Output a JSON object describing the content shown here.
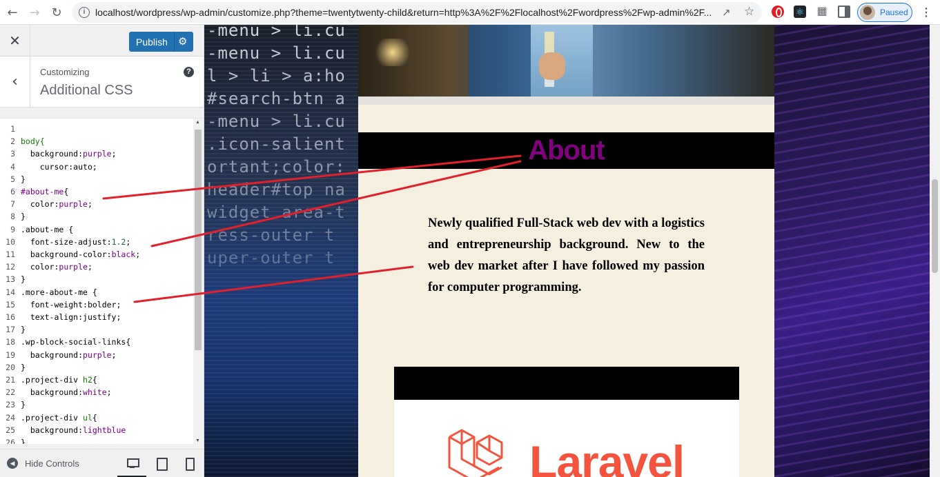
{
  "browser": {
    "url": "localhost/wordpress/wp-admin/customize.php?theme=twentytwenty-child&return=http%3A%2F%2Flocalhost%2Fwordpress%2Fwp-admin%2F...",
    "profile_status": "Paused"
  },
  "customizer": {
    "publish_label": "Publish",
    "customizing_label": "Customizing",
    "section_title": "Additional CSS",
    "hide_controls_label": "Hide Controls",
    "css_lines": [
      {
        "n": "1",
        "tokens": []
      },
      {
        "n": "2",
        "tokens": [
          {
            "t": "body{",
            "c": "sel"
          }
        ]
      },
      {
        "n": "3",
        "tokens": [
          {
            "t": "  background:",
            "c": "prop"
          },
          {
            "t": "purple",
            "c": "val"
          },
          {
            "t": ";",
            "c": "prop"
          }
        ]
      },
      {
        "n": "4",
        "tokens": [
          {
            "t": "    cursor:",
            "c": "prop"
          },
          {
            "t": "auto",
            "c": "prop"
          },
          {
            "t": ";",
            "c": "prop"
          }
        ]
      },
      {
        "n": "5",
        "tokens": [
          {
            "t": "}",
            "c": "prop"
          }
        ]
      },
      {
        "n": "6",
        "tokens": [
          {
            "t": "#about-me",
            "c": "id"
          },
          {
            "t": "{",
            "c": "prop"
          }
        ]
      },
      {
        "n": "7",
        "tokens": [
          {
            "t": "  color:",
            "c": "prop"
          },
          {
            "t": "purple",
            "c": "val"
          },
          {
            "t": ";",
            "c": "prop"
          }
        ]
      },
      {
        "n": "8",
        "tokens": [
          {
            "t": "}",
            "c": "prop"
          }
        ]
      },
      {
        "n": "9",
        "tokens": [
          {
            "t": ".about-me {",
            "c": "prop"
          }
        ]
      },
      {
        "n": "10",
        "tokens": [
          {
            "t": "  font-size-adjust:",
            "c": "prop"
          },
          {
            "t": "1.2",
            "c": "num"
          },
          {
            "t": ";",
            "c": "prop"
          }
        ]
      },
      {
        "n": "11",
        "tokens": [
          {
            "t": "  background-color:",
            "c": "prop"
          },
          {
            "t": "black",
            "c": "val"
          },
          {
            "t": ";",
            "c": "prop"
          }
        ]
      },
      {
        "n": "12",
        "tokens": [
          {
            "t": "  color:",
            "c": "prop"
          },
          {
            "t": "purple",
            "c": "val"
          },
          {
            "t": ";",
            "c": "prop"
          }
        ]
      },
      {
        "n": "13",
        "tokens": [
          {
            "t": "}",
            "c": "prop"
          }
        ]
      },
      {
        "n": "14",
        "tokens": [
          {
            "t": ".more-about-me {",
            "c": "prop"
          }
        ]
      },
      {
        "n": "15",
        "tokens": [
          {
            "t": "  font-weight:",
            "c": "prop"
          },
          {
            "t": "bolder",
            "c": "prop"
          },
          {
            "t": ";",
            "c": "prop"
          }
        ]
      },
      {
        "n": "16",
        "tokens": [
          {
            "t": "  text-align:",
            "c": "prop"
          },
          {
            "t": "justify",
            "c": "prop"
          },
          {
            "t": ";",
            "c": "prop"
          }
        ]
      },
      {
        "n": "17",
        "tokens": [
          {
            "t": "}",
            "c": "prop"
          }
        ]
      },
      {
        "n": "18",
        "tokens": [
          {
            "t": ".wp-block-social-links{",
            "c": "prop"
          }
        ]
      },
      {
        "n": "19",
        "tokens": [
          {
            "t": "  background:",
            "c": "prop"
          },
          {
            "t": "purple",
            "c": "val"
          },
          {
            "t": ";",
            "c": "prop"
          }
        ]
      },
      {
        "n": "20",
        "tokens": [
          {
            "t": "}",
            "c": "prop"
          }
        ]
      },
      {
        "n": "21",
        "tokens": [
          {
            "t": ".project-div ",
            "c": "prop"
          },
          {
            "t": "h2",
            "c": "sel"
          },
          {
            "t": "{",
            "c": "prop"
          }
        ]
      },
      {
        "n": "22",
        "tokens": [
          {
            "t": "  background:",
            "c": "prop"
          },
          {
            "t": "white",
            "c": "val"
          },
          {
            "t": ";",
            "c": "prop"
          }
        ]
      },
      {
        "n": "23",
        "tokens": [
          {
            "t": "}",
            "c": "prop"
          }
        ]
      },
      {
        "n": "24",
        "tokens": [
          {
            "t": ".project-div ",
            "c": "prop"
          },
          {
            "t": "ul",
            "c": "sel"
          },
          {
            "t": "{",
            "c": "prop"
          }
        ]
      },
      {
        "n": "25",
        "tokens": [
          {
            "t": "  background:",
            "c": "prop"
          },
          {
            "t": "lightblue",
            "c": "val"
          }
        ]
      },
      {
        "n": "26",
        "tokens": [
          {
            "t": "}",
            "c": "prop"
          }
        ]
      }
    ]
  },
  "preview": {
    "bg_code_lines": [
      "-menu > li.cu",
      "-menu > li.cu",
      "l > li > a:ho",
      "#search-btn a",
      "-menu > li.cu",
      ".icon-salient",
      "ortant;color:",
      "header#top na",
      "widget area-t",
      "ress-outer t",
      "uper-outer t"
    ],
    "about_heading": "About",
    "about_text": "Newly qualified Full-Stack web dev with a logistics and entrepreneurship background. New to the web dev market after I have followed my passion for computer programming.",
    "project_logo_text": "Laravel"
  },
  "colors": {
    "accent_purple": "#800080",
    "publish_blue": "#2271b1",
    "annotation_red": "#e0202a"
  }
}
